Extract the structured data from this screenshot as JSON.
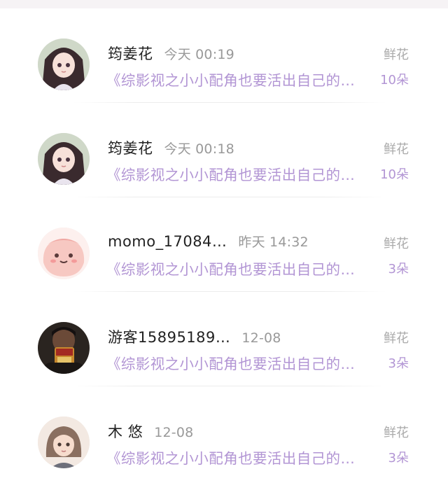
{
  "gifts": [
    {
      "avatar_icon": "anime-girl-avatar-icon",
      "name": "筠姜花",
      "time": "今天 00:19",
      "book": "《综影视之小小配角也要活出自己的…",
      "gift_type": "鲜花",
      "gift_count": "10朵"
    },
    {
      "avatar_icon": "anime-girl-avatar-icon",
      "name": "筠姜花",
      "time": "今天 00:18",
      "book": "《综影视之小小配角也要活出自己的…",
      "gift_type": "鲜花",
      "gift_count": "10朵"
    },
    {
      "avatar_icon": "pink-blob-avatar-icon",
      "name": "momo_17084…",
      "time": "昨天 14:32",
      "book": "《综影视之小小配角也要活出自己的…",
      "gift_type": "鲜花",
      "gift_count": "3朵"
    },
    {
      "avatar_icon": "photo-person-avatar-icon",
      "name": "游客15895189…",
      "time": "12-08",
      "book": "《综影视之小小配角也要活出自己的…",
      "gift_type": "鲜花",
      "gift_count": "3朵"
    },
    {
      "avatar_icon": "cartoon-girl-avatar-icon",
      "name": "木 悠",
      "time": "12-08",
      "book": "《综影视之小小配角也要活出自己的…",
      "gift_type": "鲜花",
      "gift_count": "3朵"
    }
  ],
  "colors": {
    "accent_purple": "#b295d4",
    "muted_gray": "#aaaaaa",
    "name_black": "#222222"
  }
}
